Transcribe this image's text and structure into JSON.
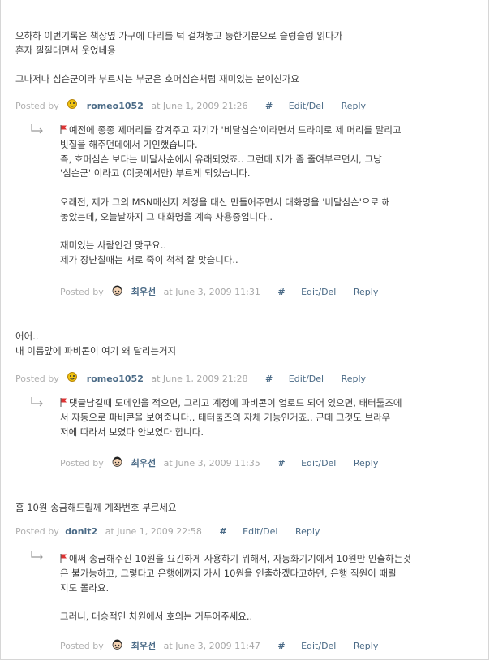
{
  "meta_common": {
    "posted_by": "Posted by",
    "at": "at",
    "hash": "#",
    "edit": "Edit/Del",
    "reply": "Reply"
  },
  "comments": [
    {
      "lines": [
        "으하하 이번기록은 책상옆 가구에 다리를 턱 걸쳐놓고 뚱한기분으로 슬렁슬렁 읽다가",
        "혼자 낄낄대면서 웃었네용",
        "",
        "그나저나 심슨군이라 부르시는 부군은 호머심슨처럼 재미있는 분이신가요"
      ],
      "author": "romeo1052",
      "date": "June 1, 2009 21:26",
      "reply": {
        "lines": [
          "예전에 종종 제머리를 감겨주고 자기가 '비달심슨'이라면서 드라이로 제 머리를 말리고",
          "빗질을 해주던데에서 기인했습니다.",
          "즉, 호머심슨 보다는 비달사순에서 유래되었죠.. 그런데 제가 좀 줄여부르면서, 그냥",
          "'심슨군' 이라고 (이곳에서만) 부르게 되었습니다.",
          "",
          "오래전, 제가 그의 MSN메신저 계정을 대신 만들어주면서 대화명을 '비달심슨'으로 해",
          "놓았는데, 오늘날까지 그 대화명을 계속 사용중입니다..",
          "",
          "재미있는 사람인건 맞구요..",
          "제가 장난칠때는 서로 죽이 척척 잘 맞습니다.."
        ],
        "author": "최우선",
        "date": "June 3, 2009 11:31"
      }
    },
    {
      "lines": [
        "어어..",
        "내 이름앞에 파비콘이 여기 왜 달리는거지"
      ],
      "author": "romeo1052",
      "date": "June 1, 2009 21:28",
      "reply": {
        "lines": [
          "댓글남길때 도메인을 적으면, 그리고 계정에 파비콘이 업로드 되어 있으면, 태터툴즈에",
          "서 자동으로 파비콘을 보여줍니다.. 태터툴즈의 자체 기능인거죠.. 근데 그것도 브라우",
          "저에 따라서 보였다 안보였다 합니다."
        ],
        "author": "최우선",
        "date": "June 3, 2009 11:35"
      }
    },
    {
      "lines": [
        "흠 10원 송금해드릴께 계좌번호 부르세요"
      ],
      "author": "donit2",
      "date": "June 1, 2009 22:58",
      "reply": {
        "lines": [
          "애써 송금해주신 10원을 요긴하게 사용하기 위해서, 자동화기기에서 10원만 인출하는것",
          "은 불가능하고, 그렇다고 은행에까지 가서 10원을 인출하겠다고하면, 은행 직원이 때릴",
          "지도 몰라요.",
          "",
          "그러니, 대승적인 차원에서 호의는 거두어주세요.."
        ],
        "author": "최우선",
        "date": "June 3, 2009 11:47"
      }
    }
  ]
}
